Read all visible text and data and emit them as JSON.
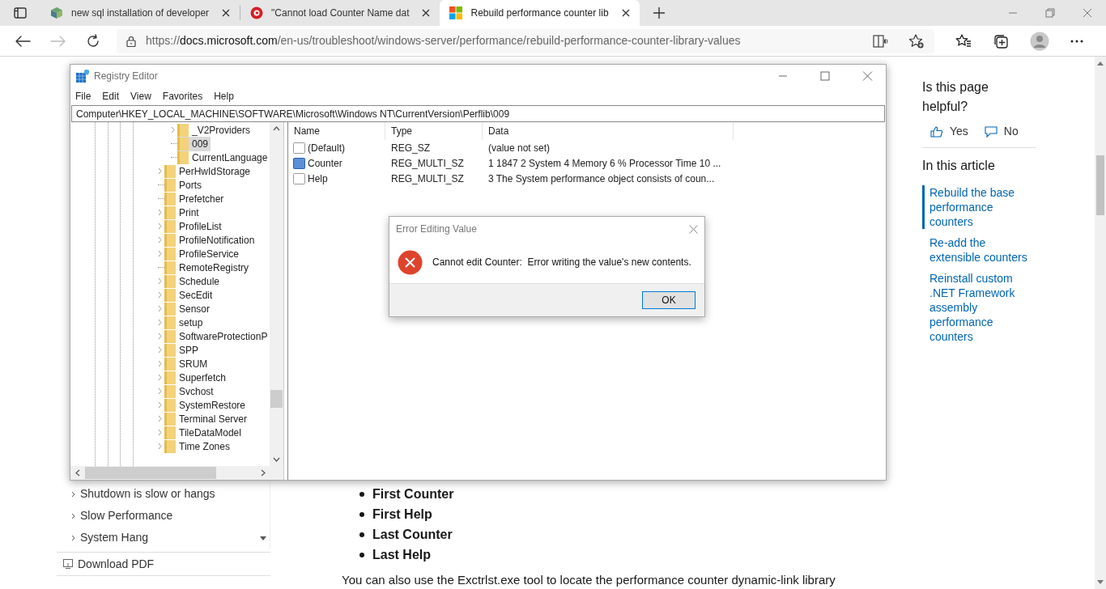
{
  "browser": {
    "tabs": [
      {
        "title": "new sql installation of developer",
        "selected": false
      },
      {
        "title": "\"Cannot load Counter Name dat",
        "selected": false
      },
      {
        "title": "Rebuild performance counter lib",
        "selected": true
      }
    ],
    "url": {
      "scheme": "https://",
      "host": "docs.microsoft.com",
      "path": "/en-us/troubleshoot/windows-server/performance/rebuild-performance-counter-library-values"
    }
  },
  "page": {
    "nav_items": [
      "Shutdown is slow or hangs",
      "Slow Performance",
      "System Hang"
    ],
    "download": "Download PDF",
    "bullets": [
      "First Counter",
      "First Help",
      "Last Counter",
      "Last Help"
    ],
    "paragraph": "You can also use the Exctrlst.exe tool to locate the performance counter dynamic-link library",
    "feedback": {
      "question": "Is this page helpful?",
      "yes": "Yes",
      "no": "No"
    },
    "toc": {
      "heading": "In this article",
      "links": [
        {
          "label": "Rebuild the base performance counters",
          "selected": true
        },
        {
          "label": "Re-add the extensible counters",
          "selected": false
        },
        {
          "label": "Reinstall custom .NET Framework assembly performance counters",
          "selected": false
        }
      ]
    }
  },
  "registry": {
    "title": "Registry Editor",
    "menu": [
      "File",
      "Edit",
      "View",
      "Favorites",
      "Help"
    ],
    "address": "Computer\\HKEY_LOCAL_MACHINE\\SOFTWARE\\Microsoft\\Windows NT\\CurrentVersion\\Perflib\\009",
    "tree": [
      {
        "children": [
          {
            "label": "_V2Providers",
            "expandable": true,
            "selected": false
          },
          {
            "label": "009",
            "expandable": false,
            "selected": true
          },
          {
            "label": "CurrentLanguage",
            "expandable": false,
            "selected": false
          }
        ]
      },
      {
        "label": "PerHwIdStorage",
        "expandable": true,
        "selected": false
      },
      {
        "label": "Ports",
        "expandable": false,
        "selected": false
      },
      {
        "label": "Prefetcher",
        "expandable": false,
        "selected": false
      },
      {
        "label": "Print",
        "expandable": true,
        "selected": false
      },
      {
        "label": "ProfileList",
        "expandable": true,
        "selected": false
      },
      {
        "label": "ProfileNotification",
        "expandable": true,
        "selected": false
      },
      {
        "label": "ProfileService",
        "expandable": true,
        "selected": false
      },
      {
        "label": "RemoteRegistry",
        "expandable": false,
        "selected": false
      },
      {
        "label": "Schedule",
        "expandable": true,
        "selected": false
      },
      {
        "label": "SecEdit",
        "expandable": true,
        "selected": false
      },
      {
        "label": "Sensor",
        "expandable": true,
        "selected": false
      },
      {
        "label": "setup",
        "expandable": true,
        "selected": false
      },
      {
        "label": "SoftwareProtectionP",
        "expandable": true,
        "selected": false
      },
      {
        "label": "SPP",
        "expandable": true,
        "selected": false
      },
      {
        "label": "SRUM",
        "expandable": true,
        "selected": false
      },
      {
        "label": "Superfetch",
        "expandable": true,
        "selected": false
      },
      {
        "label": "Svchost",
        "expandable": true,
        "selected": false
      },
      {
        "label": "SystemRestore",
        "expandable": true,
        "selected": false
      },
      {
        "label": "Terminal Server",
        "expandable": true,
        "selected": false
      },
      {
        "label": "TileDataModel",
        "expandable": true,
        "selected": false
      },
      {
        "label": "Time Zones",
        "expandable": true,
        "selected": false
      }
    ],
    "columns": [
      "Name",
      "Type",
      "Data"
    ],
    "values": [
      {
        "name": "(Default)",
        "type": "REG_SZ",
        "data": "(value not set)",
        "selected": false
      },
      {
        "name": "Counter",
        "type": "REG_MULTI_SZ",
        "data": "1 1847 2 System 4 Memory 6 % Processor Time 10 ...",
        "selected": true
      },
      {
        "name": "Help",
        "type": "REG_MULTI_SZ",
        "data": "3 The System performance object consists of coun...",
        "selected": false
      }
    ]
  },
  "dialog": {
    "title": "Error Editing Value",
    "message": "Cannot edit Counter:  Error writing the value's new contents.",
    "button": "OK"
  }
}
